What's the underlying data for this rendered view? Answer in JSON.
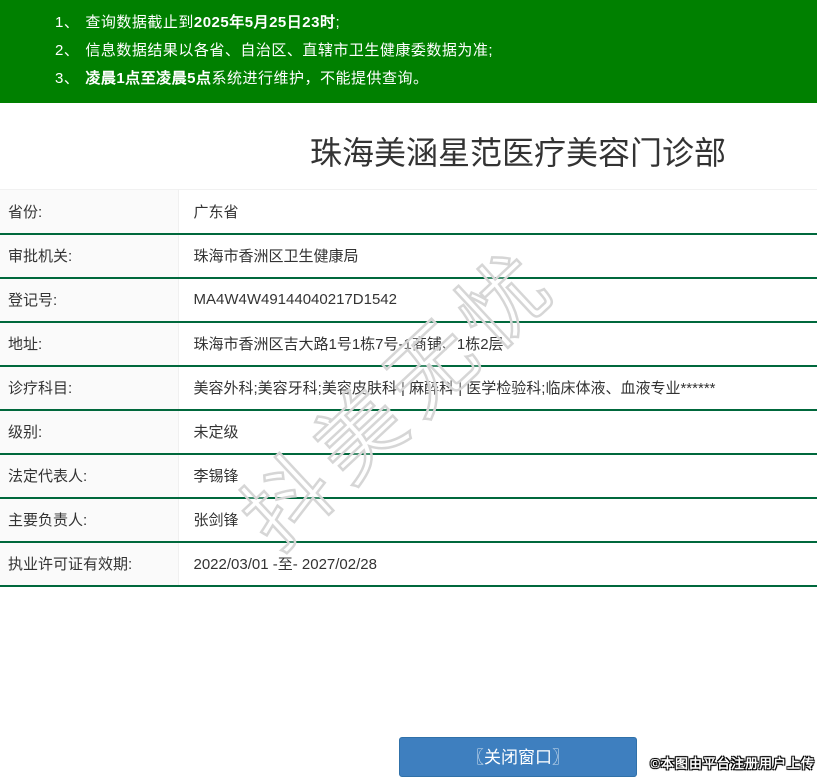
{
  "notice": {
    "items": [
      {
        "num": "1、",
        "pre": "查询数据截止到",
        "bold": "2025年5月25日23时",
        "post": ";"
      },
      {
        "num": "2、",
        "pre": "信息数据结果以各省、自治区、直辖市卫生健康委数据为准;",
        "bold": "",
        "post": ""
      },
      {
        "num": "3、",
        "pre": "",
        "bold": "凌晨1点至凌晨5点",
        "post": "系统进行维护，不能提供查询。"
      }
    ]
  },
  "title": "珠海美涵星范医疗美容门诊部",
  "table": {
    "rows": [
      {
        "label": "省份:",
        "value": "广东省"
      },
      {
        "label": "审批机关:",
        "value": "珠海市香洲区卫生健康局"
      },
      {
        "label": "登记号:",
        "value": "MA4W4W49144040217D1542"
      },
      {
        "label": "地址:",
        "value": "珠海市香洲区吉大路1号1栋7号-1商铺、1栋2层"
      },
      {
        "label": "诊疗科目:",
        "value": "美容外科;美容牙科;美容皮肤科 | 麻醉科 | 医学检验科;临床体液、血液专业******"
      },
      {
        "label": "级别:",
        "value": "未定级"
      },
      {
        "label": "法定代表人:",
        "value": "李锡锋"
      },
      {
        "label": "主要负责人:",
        "value": "张剑锋"
      },
      {
        "label": "执业许可证有效期:",
        "value": "2022/03/01 -至- 2027/02/28"
      }
    ]
  },
  "watermark": "抖美无忧",
  "button": {
    "close_label": "〖关闭窗口〗"
  },
  "badge": {
    "text": "©本图由平台注册用户上传"
  },
  "colors": {
    "banner_bg": "#008000",
    "row_border": "#00683c",
    "label_bg": "#fafafa",
    "button_bg": "#3e7fbf",
    "text": "#333333"
  }
}
